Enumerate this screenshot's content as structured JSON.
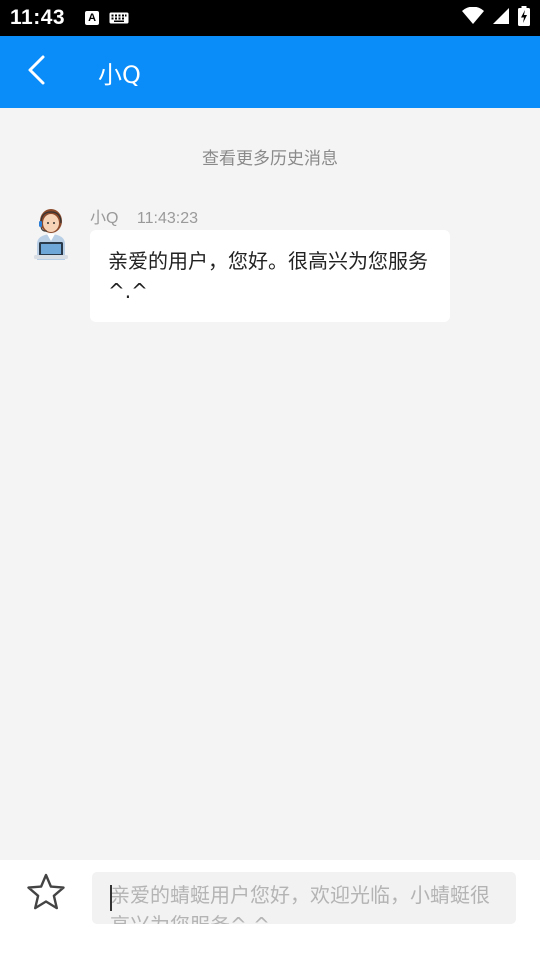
{
  "status_bar": {
    "time": "11:43",
    "notification_letter": "A",
    "icons": [
      "a-notification-icon",
      "keyboard-icon",
      "wifi-icon",
      "signal-icon",
      "battery-charging-icon"
    ]
  },
  "app_bar": {
    "title": "小Q",
    "back_icon": "chevron-left-icon",
    "background_color": "#0a8df8"
  },
  "chat": {
    "load_more_label": "查看更多历史消息",
    "messages": [
      {
        "sender": "小Q",
        "time": "11:43:23",
        "avatar": "customer-service-avatar",
        "text": "亲爱的用户，您好。很高兴为您服务^.^"
      }
    ]
  },
  "input_bar": {
    "favorite_icon": "star-outline-icon",
    "placeholder": "亲爱的蜻蜓用户您好，欢迎光临，小蜻蜓很高兴为您服务^.^"
  }
}
